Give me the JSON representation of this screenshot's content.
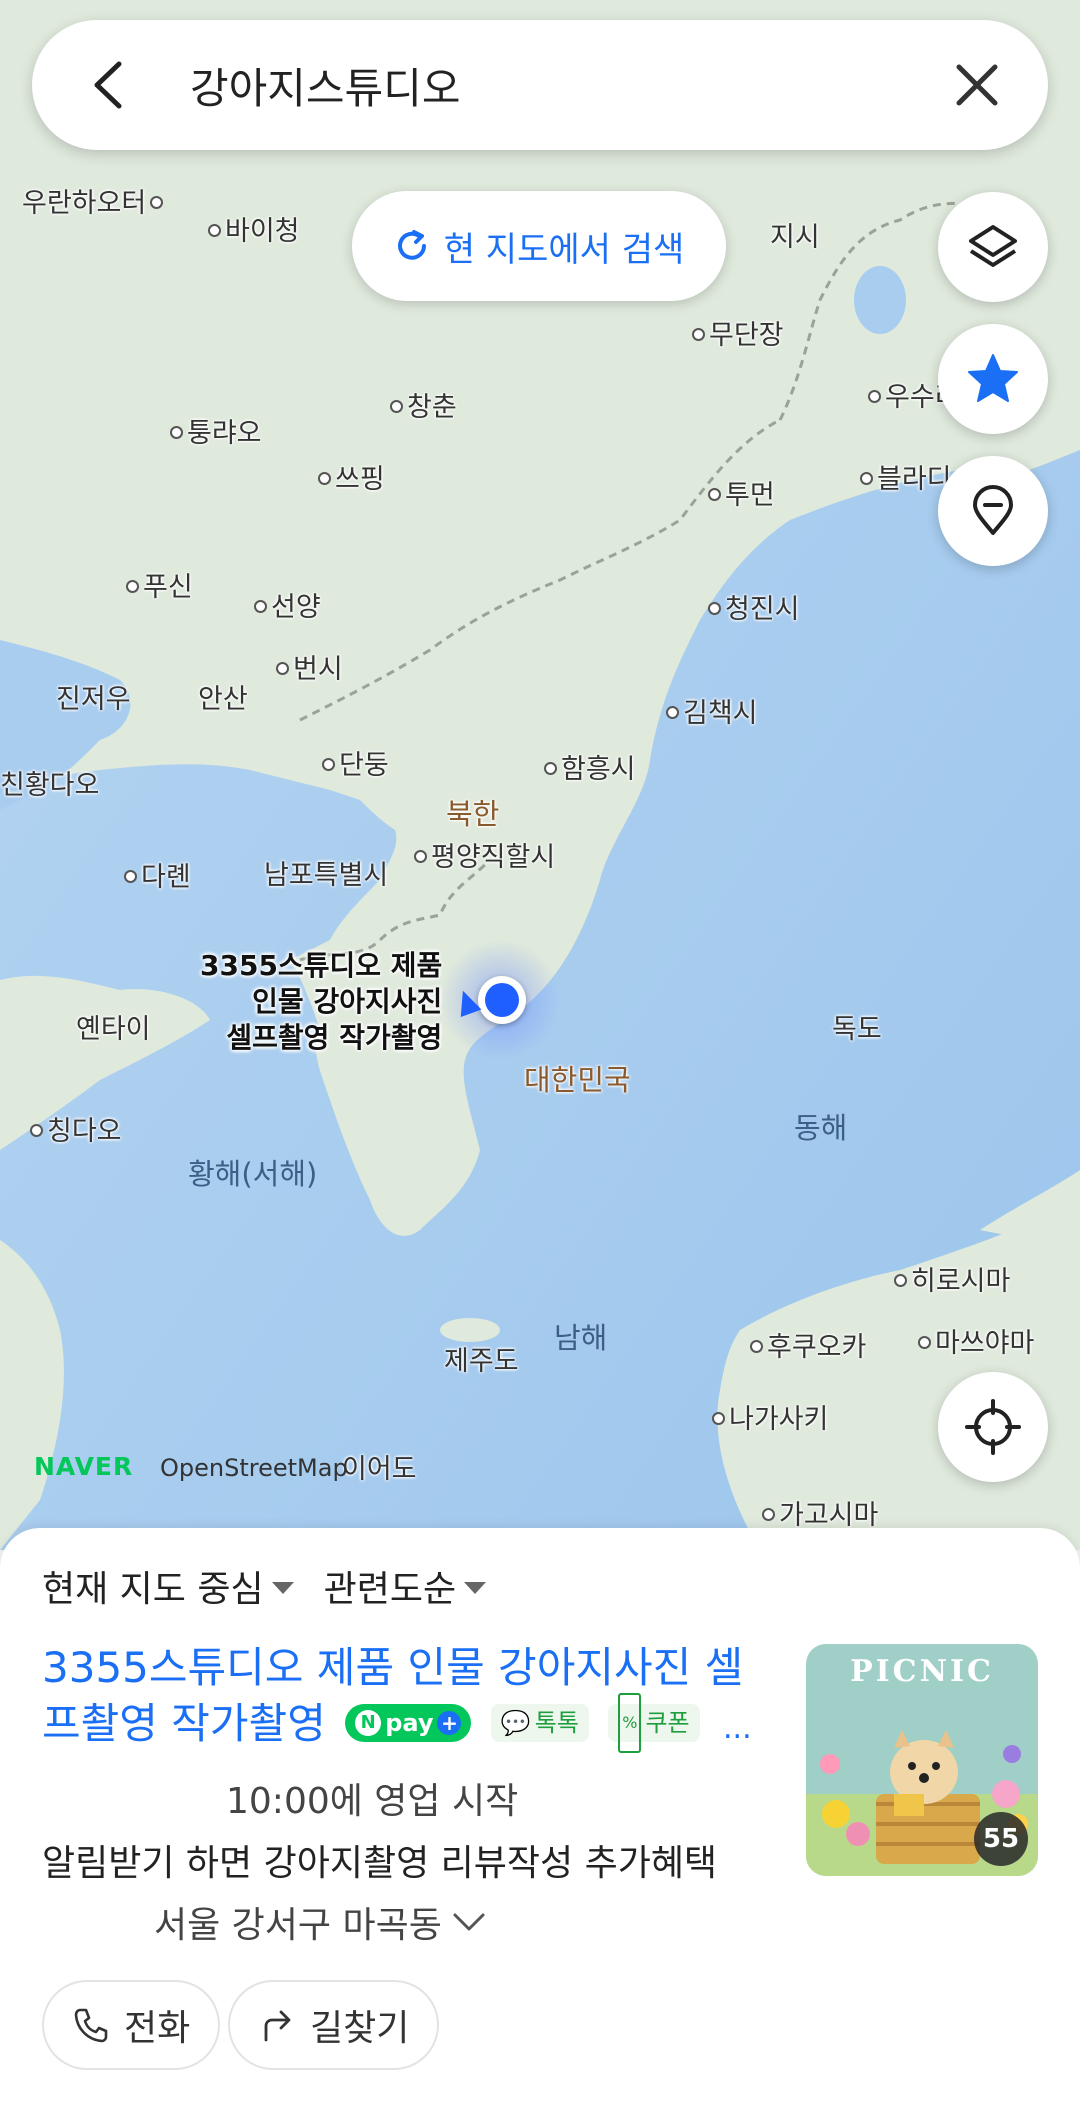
{
  "search": {
    "query": "강아지스튜디오"
  },
  "map": {
    "research_label": "현 지도에서 검색",
    "attribution_naver": "NAVER",
    "attribution_osm": "OpenStreetMap",
    "place_labels": [
      {
        "text": "우란하오터"
      },
      {
        "text": "바이청"
      },
      {
        "text": "지시"
      },
      {
        "text": "무단장"
      },
      {
        "text": "창춘"
      },
      {
        "text": "퉁랴오"
      },
      {
        "text": "쓰핑"
      },
      {
        "text": "투먼"
      },
      {
        "text": "푸신"
      },
      {
        "text": "선양"
      },
      {
        "text": "청진시"
      },
      {
        "text": "진저우"
      },
      {
        "text": "안산"
      },
      {
        "text": "번시"
      },
      {
        "text": "김책시"
      },
      {
        "text": "단둥"
      },
      {
        "text": "함흥시"
      },
      {
        "text": "친황다오"
      },
      {
        "text": "다롄"
      },
      {
        "text": "남포특별시"
      },
      {
        "text": "평양직할시"
      },
      {
        "text": "옌타이"
      },
      {
        "text": "칭다오"
      },
      {
        "text": "히로시마"
      },
      {
        "text": "후쿠오카"
      },
      {
        "text": "마쓰야마"
      },
      {
        "text": "나가사키"
      },
      {
        "text": "이어도"
      },
      {
        "text": "가고시마"
      },
      {
        "text": "블라디"
      },
      {
        "text": "우수리"
      }
    ],
    "region_labels": {
      "north_korea": "북한",
      "south_korea": "대한민국",
      "yellow_sea": "황해(서해)",
      "east_sea": "동해",
      "dokdo": "독도",
      "south_sea": "남해",
      "jeju": "제주도"
    },
    "pin_label": [
      "3355스튜디오 제품",
      "인물 강아지사진",
      "셀프촬영 작가촬영"
    ]
  },
  "sheet": {
    "filter_center": "현재 지도 중심",
    "filter_sort": "관련도순",
    "result": {
      "title": "3355스튜디오 제품 인물 강아지사진 셀프촬영 작가촬영",
      "badge_npay": "pay",
      "badge_talk": "톡톡",
      "badge_coupon": "쿠폰",
      "badge_more": "...",
      "hours": "10:00에 영업 시작",
      "description": "알림받기 하면 강아지촬영 리뷰작성 추가혜택",
      "address": "서울 강서구 마곡동",
      "photo_title": "PICNIC",
      "photo_count": "55"
    },
    "actions": {
      "call": "전화",
      "directions": "길찾기"
    }
  },
  "colors": {
    "accent": "#1a6ff5",
    "naver_green": "#03c75a",
    "sea": "#a9cdef",
    "land": "#dfe9dc"
  }
}
